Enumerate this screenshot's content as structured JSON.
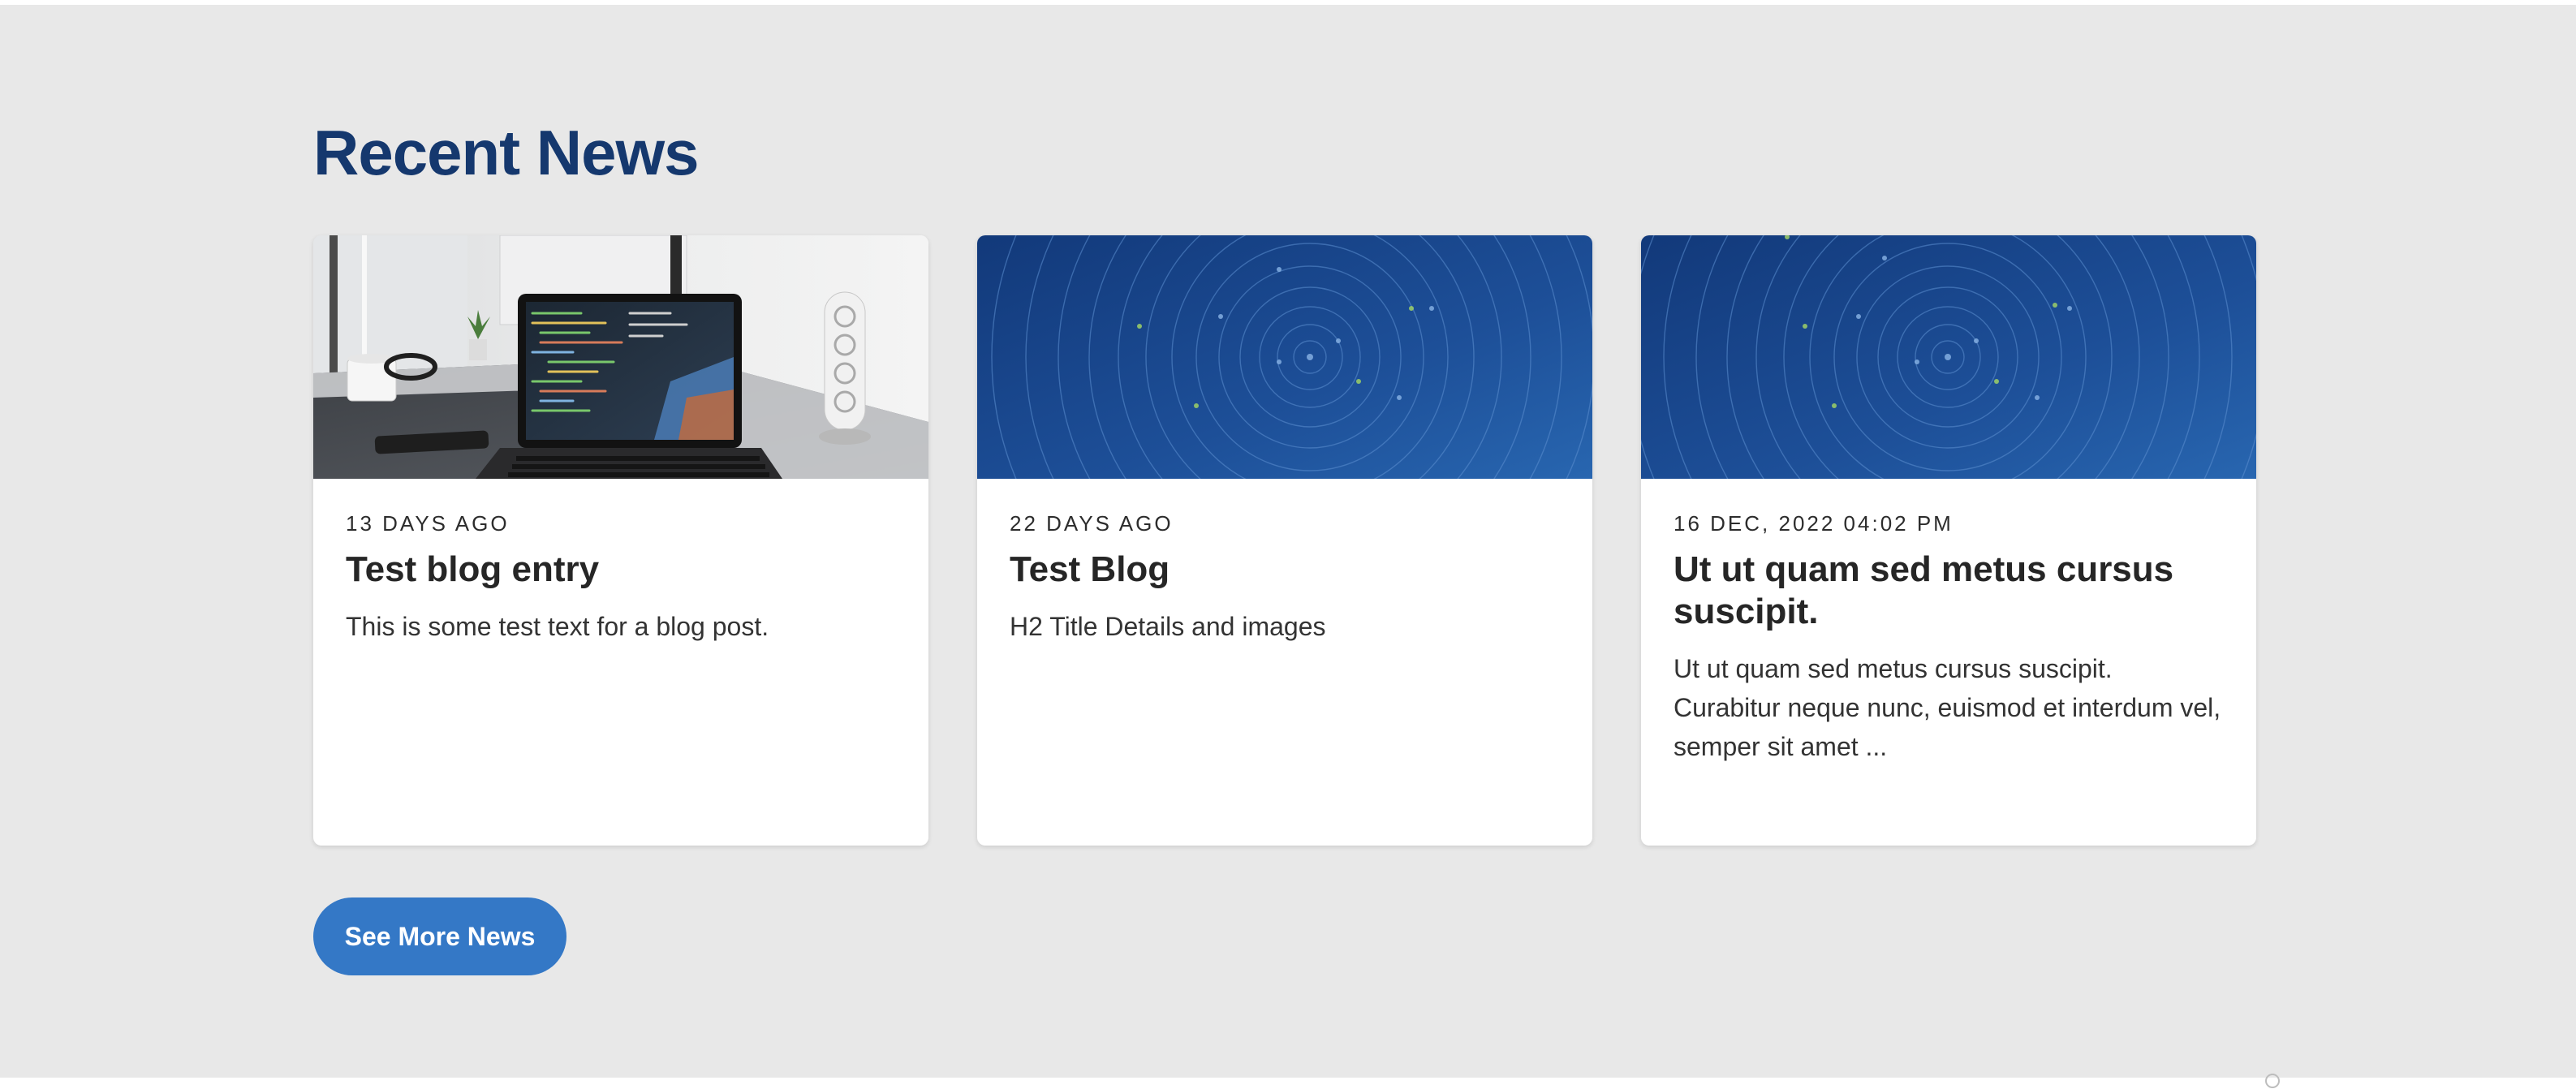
{
  "section": {
    "title": "Recent News",
    "button_label": "See More News"
  },
  "cards": [
    {
      "date": "13 DAYS AGO",
      "title": "Test blog entry",
      "excerpt": "This is some test text for a blog post.",
      "image": "laptop-desk-photo"
    },
    {
      "date": "22 DAYS AGO",
      "title": "Test Blog",
      "excerpt": "H2 Title Details and images",
      "image": "blue-concentric-circles"
    },
    {
      "date": "16 DEC, 2022 04:02 PM",
      "title": "Ut ut quam sed metus cursus suscipit.",
      "excerpt": "Ut ut quam sed metus cursus suscipit. Curabitur neque nunc, euismod et interdum vel, semper sit amet ...",
      "image": "blue-concentric-circles"
    }
  ],
  "colors": {
    "heading": "#15386e",
    "button": "#3478c6",
    "background": "#e8e8e8",
    "card_image_blue": "#1b4f96"
  }
}
